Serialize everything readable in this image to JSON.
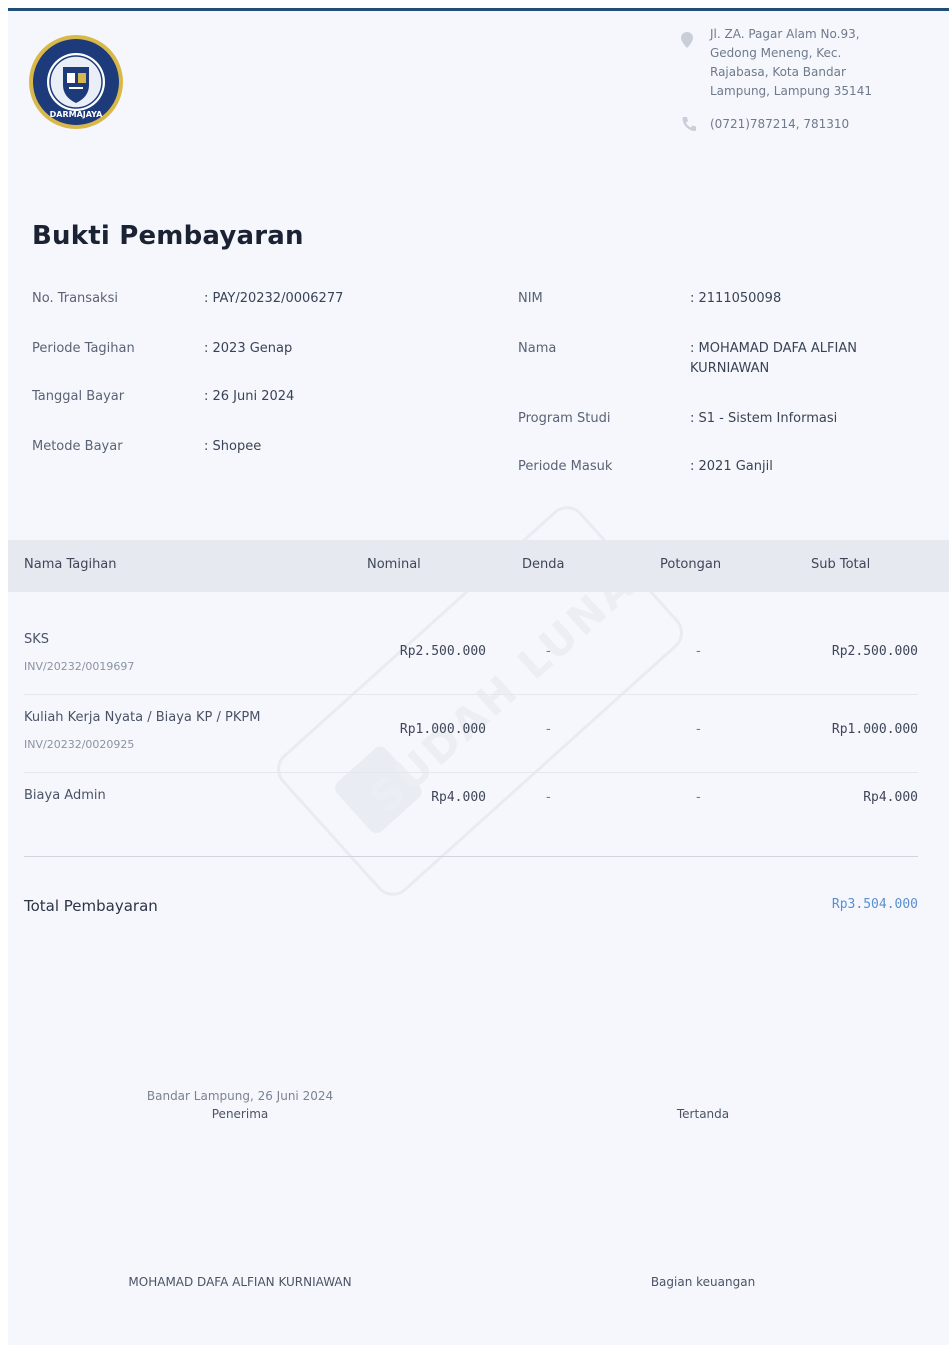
{
  "header": {
    "logo_text": "DARMAJAYA",
    "address": "Jl. ZA. Pagar Alam No.93, Gedong Meneng, Kec. Rajabasa, Kota Bandar Lampung, Lampung 35141",
    "phone": "(0721)787214, 781310",
    "address_icon": "map-pin-icon",
    "phone_icon": "phone-icon"
  },
  "title": "Bukti Pembayaran",
  "info_left": [
    {
      "label": "No. Transaksi",
      "value": ": PAY/20232/0006277"
    },
    {
      "label": "Periode Tagihan",
      "value": ": 2023 Genap"
    },
    {
      "label": "Tanggal Bayar",
      "value": ": 26 Juni 2024"
    },
    {
      "label": "Metode Bayar",
      "value": ": Shopee"
    }
  ],
  "info_right": [
    {
      "label": "NIM",
      "value": ": 2111050098"
    },
    {
      "label": "Nama",
      "value": ": MOHAMAD DAFA ALFIAN KURNIAWAN"
    },
    {
      "label": "Program Studi",
      "value": ": S1 - Sistem Informasi"
    },
    {
      "label": "Periode Masuk",
      "value": ": 2021 Ganjil"
    }
  ],
  "watermark": "SUDAH LUNAS",
  "table": {
    "headers": [
      "Nama Tagihan",
      "Nominal",
      "Denda",
      "Potongan",
      "Sub Total"
    ],
    "rows": [
      {
        "name": "SKS",
        "invoice": "INV/20232/0019697",
        "nominal": "Rp2.500.000",
        "denda": "-",
        "potongan": "-",
        "subtotal": "Rp2.500.000"
      },
      {
        "name": "Kuliah Kerja Nyata / Biaya KP / PKPM",
        "invoice": "INV/20232/0020925",
        "nominal": "Rp1.000.000",
        "denda": "-",
        "potongan": "-",
        "subtotal": "Rp1.000.000"
      },
      {
        "name": "Biaya Admin",
        "invoice": "",
        "nominal": "Rp4.000",
        "denda": "-",
        "potongan": "-",
        "subtotal": "Rp4.000"
      }
    ]
  },
  "total": {
    "label": "Total Pembayaran",
    "value": "Rp3.504.000"
  },
  "signature": {
    "left_place_date": "Bandar Lampung, 26 Juni 2024",
    "left_role": "Penerima",
    "left_name": "MOHAMAD DAFA ALFIAN KURNIAWAN",
    "right_role": "Tertanda",
    "right_name": "Bagian keuangan"
  },
  "colors": {
    "accent": "#1f4e79",
    "total_value": "#5b8fd1",
    "header_bg": "#e6e9ef"
  }
}
